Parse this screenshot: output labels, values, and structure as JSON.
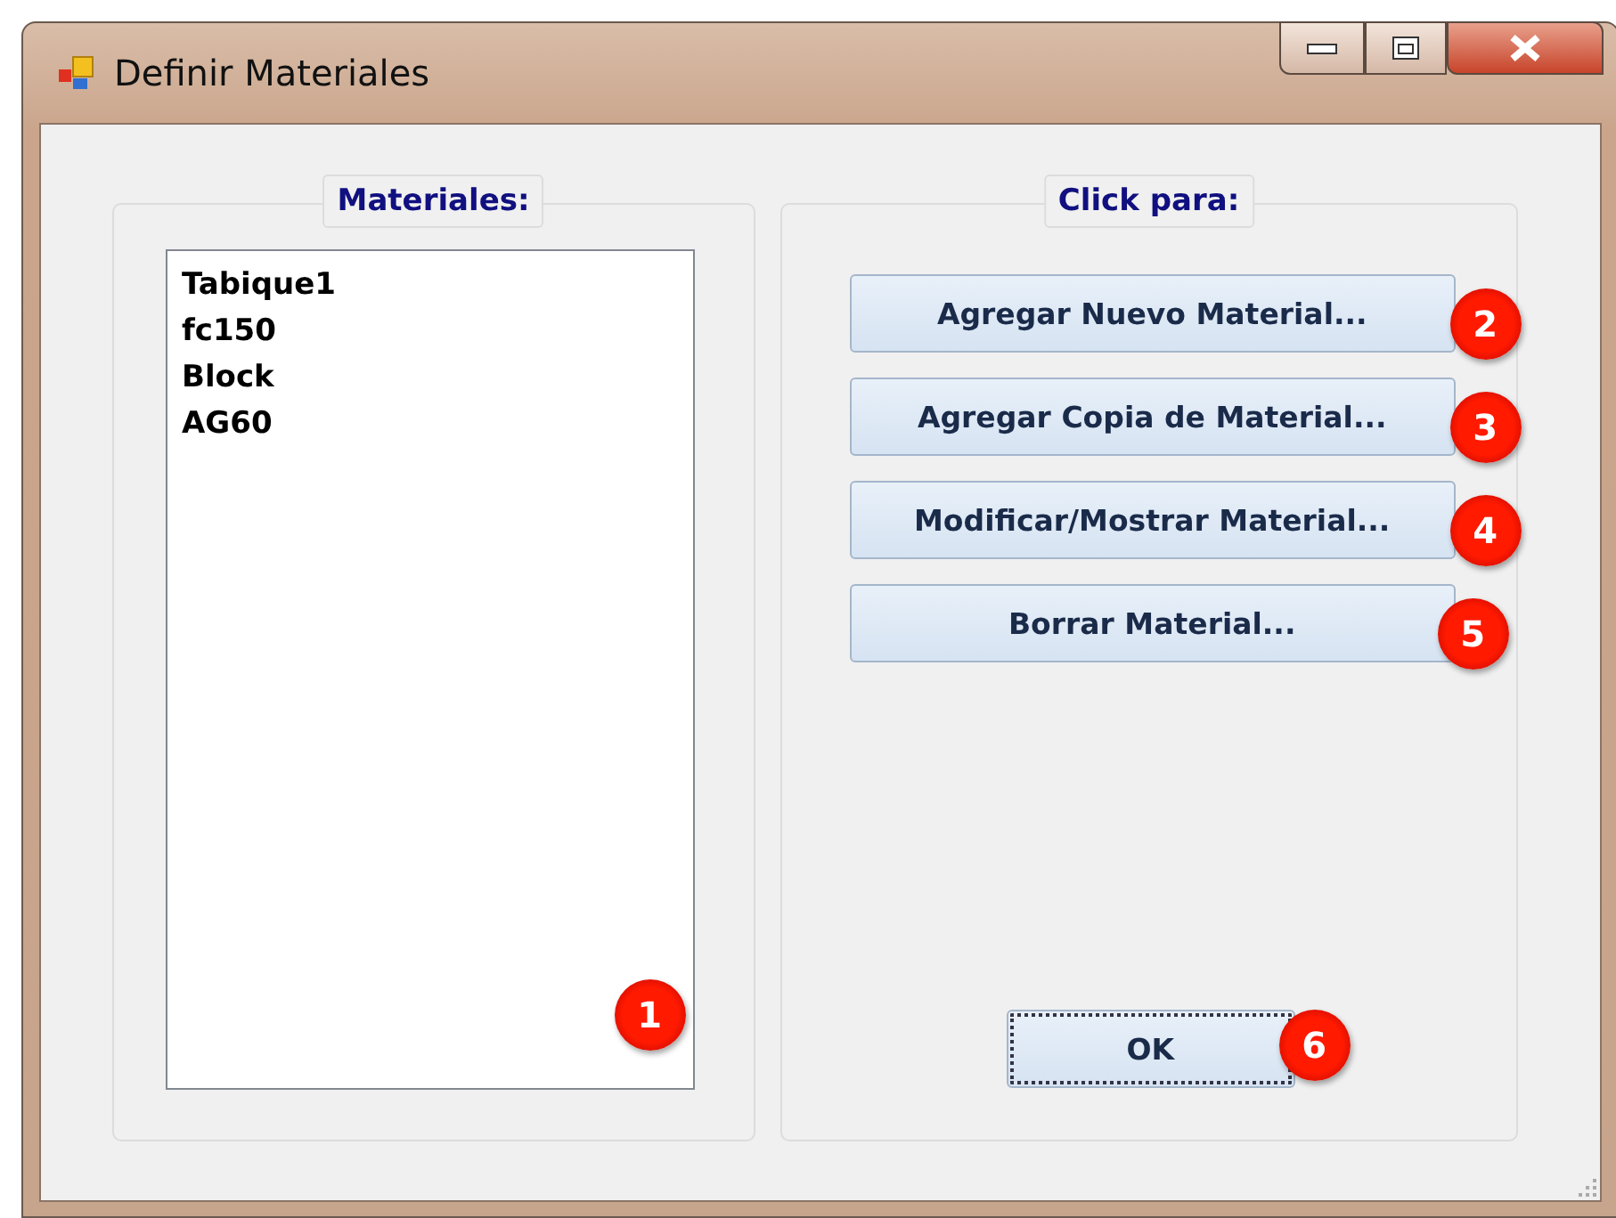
{
  "window": {
    "title": "Definir Materiales"
  },
  "materials_group": {
    "title": "Materiales:",
    "items": [
      "Tabique1",
      "fc150",
      "Block",
      "AG60"
    ],
    "marker": "1"
  },
  "actions_group": {
    "title": "Click para:",
    "buttons": [
      {
        "label": "Agregar Nuevo Material...",
        "marker": "2"
      },
      {
        "label": "Agregar Copia de Material...",
        "marker": "3"
      },
      {
        "label": "Modificar/Mostrar Material...",
        "marker": "4"
      },
      {
        "label": "Borrar Material...",
        "marker": "5"
      }
    ]
  },
  "ok_button": {
    "label": "OK",
    "focused": true,
    "marker": "6"
  }
}
